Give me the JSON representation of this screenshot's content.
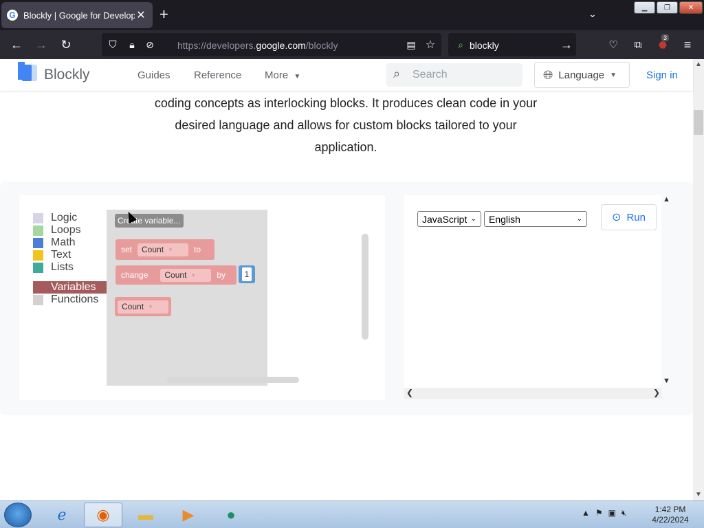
{
  "browser": {
    "tab_title": "Blockly | Google for Developers",
    "tab_favicon": "google-g-icon",
    "url_prefix": "https://developers.",
    "url_host": "google.com",
    "url_path": "/blockly",
    "search_query": "blockly",
    "extension_badge": "3",
    "icons": [
      "back-arrow-icon",
      "forward-arrow-icon",
      "reload-icon",
      "shield-icon",
      "lock-icon",
      "tracking-icon",
      "reader-view-icon",
      "bookmark-star-icon",
      "go-arrow-icon",
      "pocket-icon",
      "extensions-icon",
      "ublock-icon",
      "menu-icon"
    ]
  },
  "site": {
    "brand": "Blockly",
    "nav": [
      "Guides",
      "Reference",
      "More"
    ],
    "search_placeholder": "Search",
    "language_label": "Language",
    "signin_label": "Sign in",
    "accent_color": "#1a73e8"
  },
  "intro": {
    "line1": "coding concepts as interlocking blocks. It produces clean code in your",
    "line2": "desired language and allows for custom blocks tailored to your",
    "line3": "application."
  },
  "toolbox": {
    "categories": [
      {
        "label": "Logic",
        "color": "#d8d3e6"
      },
      {
        "label": "Loops",
        "color": "#a5d6a0"
      },
      {
        "label": "Math",
        "color": "#4a7ed8"
      },
      {
        "label": "Text",
        "color": "#f2c318"
      },
      {
        "label": "Lists",
        "color": "#3fa99a"
      },
      {
        "label": "Variables",
        "color": "#a55b5b"
      },
      {
        "label": "Functions",
        "color": "#d6cfcf"
      }
    ],
    "selected": "Variables"
  },
  "flyout": {
    "create_variable": "Create variable...",
    "set_label": "set",
    "set_var": "Count",
    "to_label": "to",
    "change_label": "change",
    "change_var": "Count",
    "by_label": "by",
    "change_value": "1",
    "getter_var": "Count",
    "block_color": "#e89b9b"
  },
  "output": {
    "language_select": "JavaScript",
    "locale_select": "English",
    "run_label": "Run"
  },
  "taskbar": {
    "apps": [
      "internet-explorer-icon",
      "firefox-icon",
      "file-explorer-icon",
      "media-player-icon",
      "app-icon"
    ],
    "time": "1:42 PM",
    "date": "4/22/2024"
  }
}
